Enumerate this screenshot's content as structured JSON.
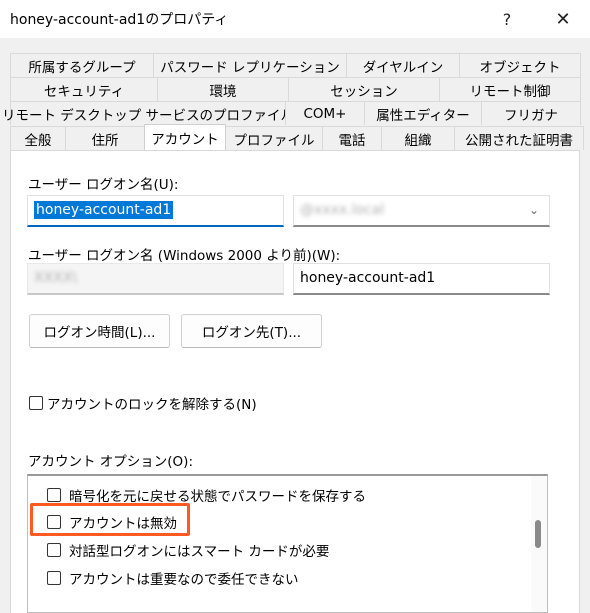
{
  "window": {
    "title": "honey-account-ad1のプロパティ",
    "help_glyph": "?",
    "close_glyph": "✕"
  },
  "tabs": {
    "row1": [
      "所属するグループ",
      "パスワード レプリケーション",
      "ダイヤルイン",
      "オブジェクト"
    ],
    "row2": [
      "セキュリティ",
      "環境",
      "セッション",
      "リモート制御"
    ],
    "row3": [
      "リモート デスクトップ サービスのプロファイル",
      "COM+",
      "属性エディター",
      "フリガナ"
    ],
    "row4": [
      "全般",
      "住所",
      "アカウント",
      "プロファイル",
      "電話",
      "組織",
      "公開された証明書"
    ],
    "active": "アカウント"
  },
  "account": {
    "logon_name_label": "ユーザー ログオン名(U):",
    "logon_name_value": "honey-account-ad1",
    "domain_suffix_value": "@xxxx.local",
    "pre2000_label": "ユーザー ログオン名 (Windows 2000 より前)(W):",
    "pre2000_domain_value": "XXXX\\",
    "pre2000_name_value": "honey-account-ad1",
    "logon_hours_button": "ログオン時間(L)...",
    "logon_to_button": "ログオン先(T)...",
    "unlock_label": "アカウントのロックを解除する(N)",
    "options_label": "アカウント オプション(O):",
    "options": [
      "暗号化を元に戻せる状態でパスワードを保存する",
      "アカウントは無効",
      "対話型ログオンにはスマート カードが必要",
      "アカウントは重要なので委任できない"
    ]
  },
  "colors": {
    "highlight": "#ff5a1f",
    "selection": "#0078d7"
  }
}
